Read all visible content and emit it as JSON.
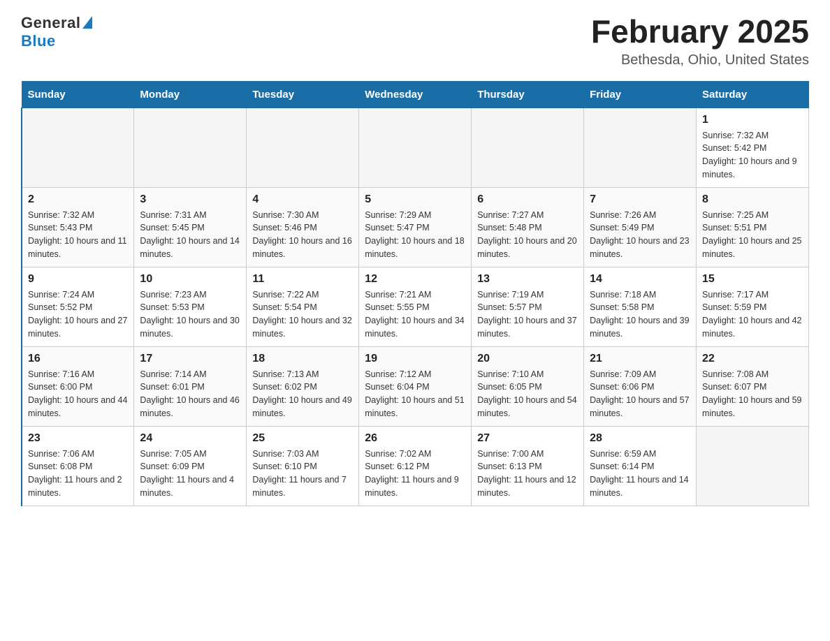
{
  "logo": {
    "general": "General",
    "blue": "Blue"
  },
  "header": {
    "month": "February 2025",
    "location": "Bethesda, Ohio, United States"
  },
  "days_of_week": [
    "Sunday",
    "Monday",
    "Tuesday",
    "Wednesday",
    "Thursday",
    "Friday",
    "Saturday"
  ],
  "weeks": [
    [
      {
        "day": "",
        "info": ""
      },
      {
        "day": "",
        "info": ""
      },
      {
        "day": "",
        "info": ""
      },
      {
        "day": "",
        "info": ""
      },
      {
        "day": "",
        "info": ""
      },
      {
        "day": "",
        "info": ""
      },
      {
        "day": "1",
        "info": "Sunrise: 7:32 AM\nSunset: 5:42 PM\nDaylight: 10 hours and 9 minutes."
      }
    ],
    [
      {
        "day": "2",
        "info": "Sunrise: 7:32 AM\nSunset: 5:43 PM\nDaylight: 10 hours and 11 minutes."
      },
      {
        "day": "3",
        "info": "Sunrise: 7:31 AM\nSunset: 5:45 PM\nDaylight: 10 hours and 14 minutes."
      },
      {
        "day": "4",
        "info": "Sunrise: 7:30 AM\nSunset: 5:46 PM\nDaylight: 10 hours and 16 minutes."
      },
      {
        "day": "5",
        "info": "Sunrise: 7:29 AM\nSunset: 5:47 PM\nDaylight: 10 hours and 18 minutes."
      },
      {
        "day": "6",
        "info": "Sunrise: 7:27 AM\nSunset: 5:48 PM\nDaylight: 10 hours and 20 minutes."
      },
      {
        "day": "7",
        "info": "Sunrise: 7:26 AM\nSunset: 5:49 PM\nDaylight: 10 hours and 23 minutes."
      },
      {
        "day": "8",
        "info": "Sunrise: 7:25 AM\nSunset: 5:51 PM\nDaylight: 10 hours and 25 minutes."
      }
    ],
    [
      {
        "day": "9",
        "info": "Sunrise: 7:24 AM\nSunset: 5:52 PM\nDaylight: 10 hours and 27 minutes."
      },
      {
        "day": "10",
        "info": "Sunrise: 7:23 AM\nSunset: 5:53 PM\nDaylight: 10 hours and 30 minutes."
      },
      {
        "day": "11",
        "info": "Sunrise: 7:22 AM\nSunset: 5:54 PM\nDaylight: 10 hours and 32 minutes."
      },
      {
        "day": "12",
        "info": "Sunrise: 7:21 AM\nSunset: 5:55 PM\nDaylight: 10 hours and 34 minutes."
      },
      {
        "day": "13",
        "info": "Sunrise: 7:19 AM\nSunset: 5:57 PM\nDaylight: 10 hours and 37 minutes."
      },
      {
        "day": "14",
        "info": "Sunrise: 7:18 AM\nSunset: 5:58 PM\nDaylight: 10 hours and 39 minutes."
      },
      {
        "day": "15",
        "info": "Sunrise: 7:17 AM\nSunset: 5:59 PM\nDaylight: 10 hours and 42 minutes."
      }
    ],
    [
      {
        "day": "16",
        "info": "Sunrise: 7:16 AM\nSunset: 6:00 PM\nDaylight: 10 hours and 44 minutes."
      },
      {
        "day": "17",
        "info": "Sunrise: 7:14 AM\nSunset: 6:01 PM\nDaylight: 10 hours and 46 minutes."
      },
      {
        "day": "18",
        "info": "Sunrise: 7:13 AM\nSunset: 6:02 PM\nDaylight: 10 hours and 49 minutes."
      },
      {
        "day": "19",
        "info": "Sunrise: 7:12 AM\nSunset: 6:04 PM\nDaylight: 10 hours and 51 minutes."
      },
      {
        "day": "20",
        "info": "Sunrise: 7:10 AM\nSunset: 6:05 PM\nDaylight: 10 hours and 54 minutes."
      },
      {
        "day": "21",
        "info": "Sunrise: 7:09 AM\nSunset: 6:06 PM\nDaylight: 10 hours and 57 minutes."
      },
      {
        "day": "22",
        "info": "Sunrise: 7:08 AM\nSunset: 6:07 PM\nDaylight: 10 hours and 59 minutes."
      }
    ],
    [
      {
        "day": "23",
        "info": "Sunrise: 7:06 AM\nSunset: 6:08 PM\nDaylight: 11 hours and 2 minutes."
      },
      {
        "day": "24",
        "info": "Sunrise: 7:05 AM\nSunset: 6:09 PM\nDaylight: 11 hours and 4 minutes."
      },
      {
        "day": "25",
        "info": "Sunrise: 7:03 AM\nSunset: 6:10 PM\nDaylight: 11 hours and 7 minutes."
      },
      {
        "day": "26",
        "info": "Sunrise: 7:02 AM\nSunset: 6:12 PM\nDaylight: 11 hours and 9 minutes."
      },
      {
        "day": "27",
        "info": "Sunrise: 7:00 AM\nSunset: 6:13 PM\nDaylight: 11 hours and 12 minutes."
      },
      {
        "day": "28",
        "info": "Sunrise: 6:59 AM\nSunset: 6:14 PM\nDaylight: 11 hours and 14 minutes."
      },
      {
        "day": "",
        "info": ""
      }
    ]
  ]
}
